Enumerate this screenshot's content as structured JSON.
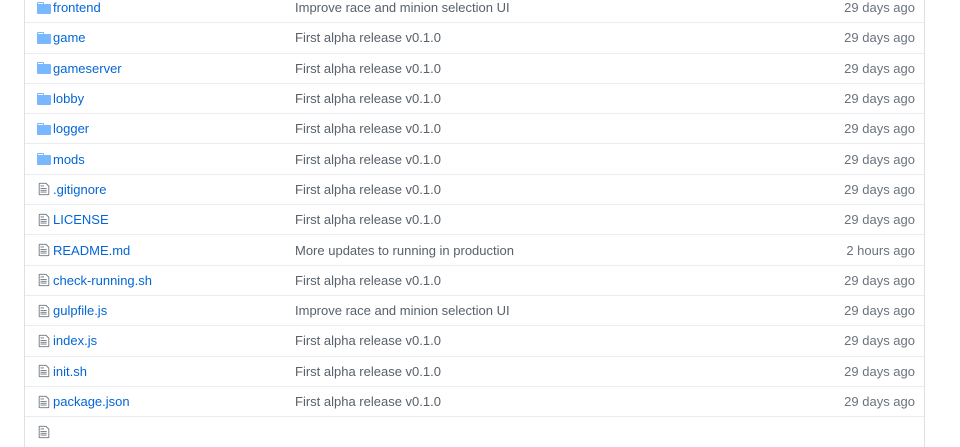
{
  "files": [
    {
      "name": "frontend",
      "type": "dir",
      "message": "Improve race and minion selection UI",
      "age": "29 days ago"
    },
    {
      "name": "game",
      "type": "dir",
      "message": "First alpha release v0.1.0",
      "age": "29 days ago"
    },
    {
      "name": "gameserver",
      "type": "dir",
      "message": "First alpha release v0.1.0",
      "age": "29 days ago"
    },
    {
      "name": "lobby",
      "type": "dir",
      "message": "First alpha release v0.1.0",
      "age": "29 days ago"
    },
    {
      "name": "logger",
      "type": "dir",
      "message": "First alpha release v0.1.0",
      "age": "29 days ago"
    },
    {
      "name": "mods",
      "type": "dir",
      "message": "First alpha release v0.1.0",
      "age": "29 days ago"
    },
    {
      "name": ".gitignore",
      "type": "file",
      "message": "First alpha release v0.1.0",
      "age": "29 days ago"
    },
    {
      "name": "LICENSE",
      "type": "file",
      "message": "First alpha release v0.1.0",
      "age": "29 days ago"
    },
    {
      "name": "README.md",
      "type": "file",
      "message": "More updates to running in production",
      "age": "2 hours ago"
    },
    {
      "name": "check-running.sh",
      "type": "file",
      "message": "First alpha release v0.1.0",
      "age": "29 days ago"
    },
    {
      "name": "gulpfile.js",
      "type": "file",
      "message": "Improve race and minion selection UI",
      "age": "29 days ago"
    },
    {
      "name": "index.js",
      "type": "file",
      "message": "First alpha release v0.1.0",
      "age": "29 days ago"
    },
    {
      "name": "init.sh",
      "type": "file",
      "message": "First alpha release v0.1.0",
      "age": "29 days ago"
    },
    {
      "name": "package.json",
      "type": "file",
      "message": "First alpha release v0.1.0",
      "age": "29 days ago"
    },
    {
      "name": "",
      "type": "file",
      "message": "",
      "age": ""
    }
  ],
  "colors": {
    "link": "#0366d6",
    "folder_icon": "#79b8ff",
    "file_icon": "#6a737d",
    "message": "#586069",
    "age": "#6a737d"
  }
}
